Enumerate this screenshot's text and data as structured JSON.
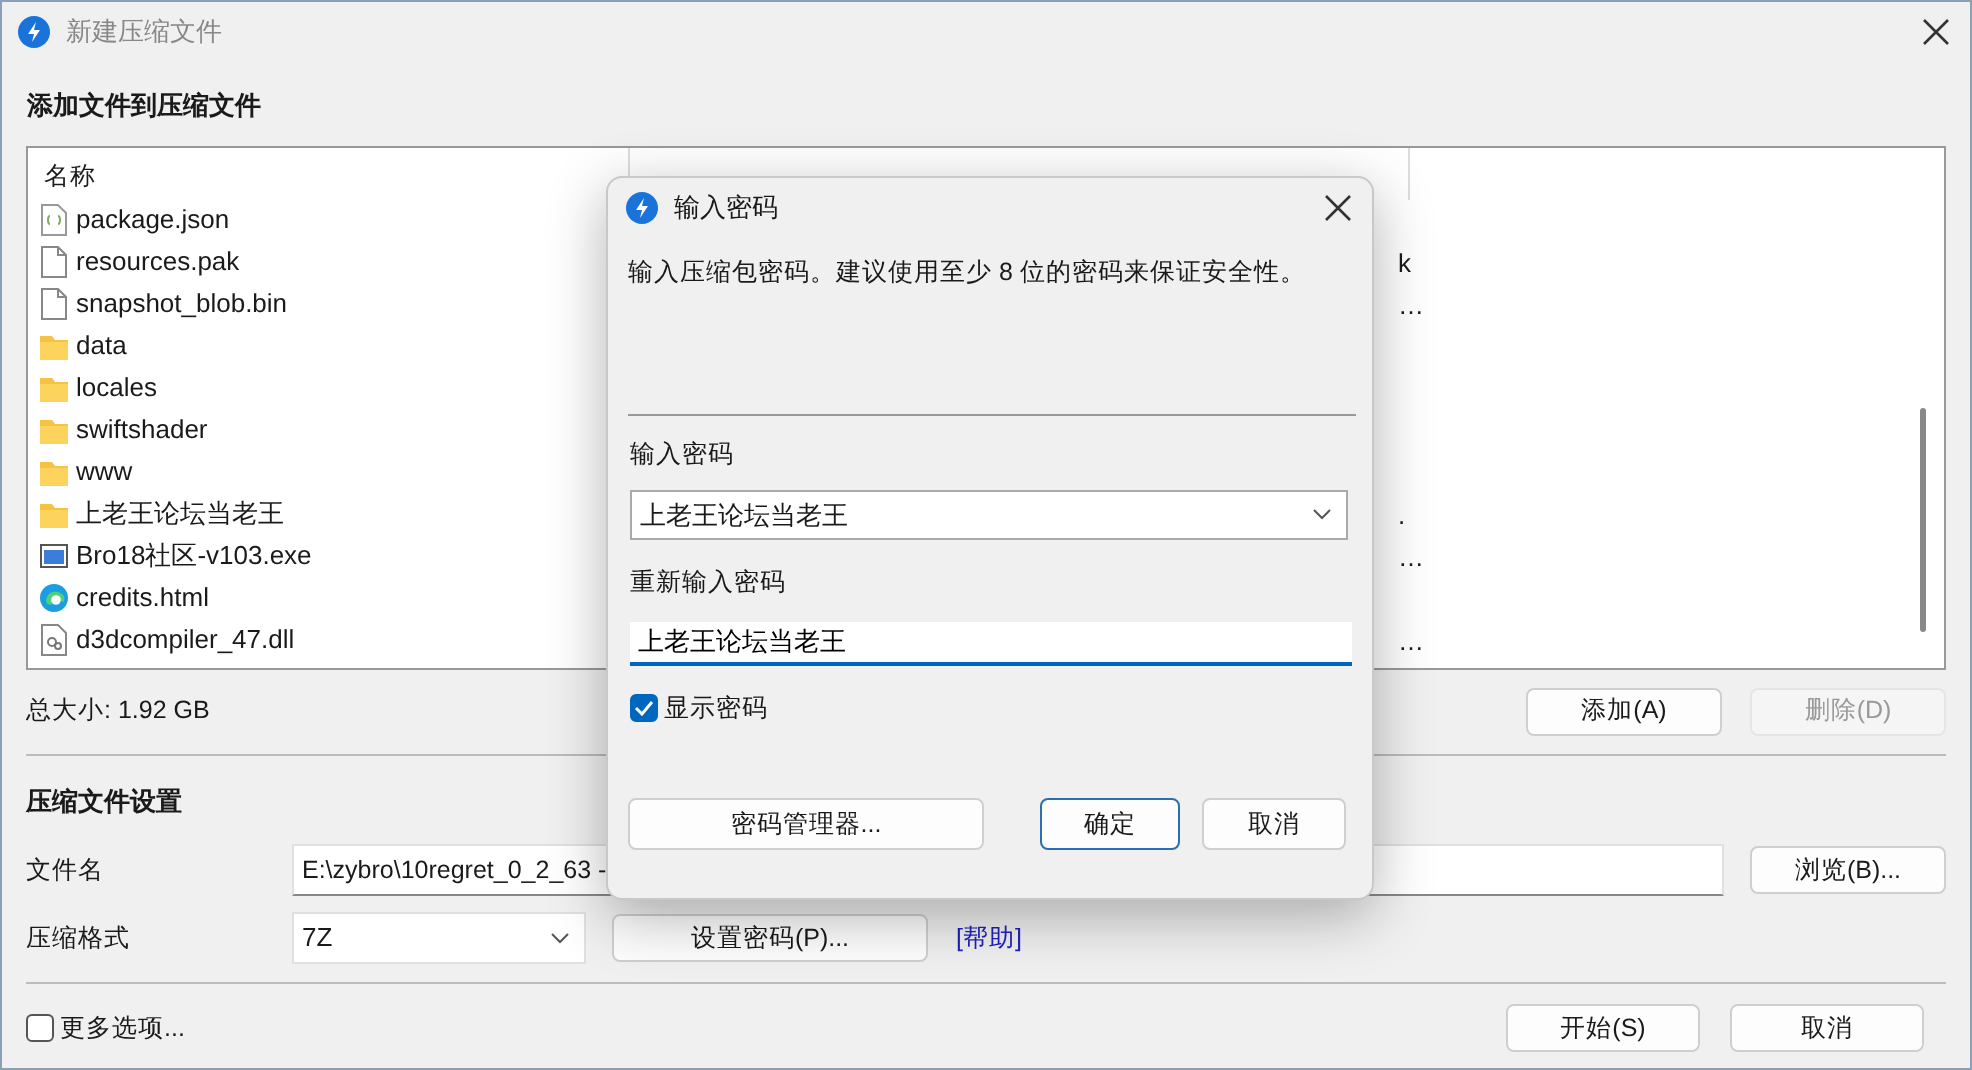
{
  "window": {
    "title": "新建压缩文件"
  },
  "add_section": {
    "heading": "添加文件到压缩文件"
  },
  "file_list": {
    "columns": [
      "名称"
    ],
    "rows": [
      {
        "kind": "json",
        "name": "package.json"
      },
      {
        "kind": "file",
        "name": "resources.pak",
        "path_tail": "k"
      },
      {
        "kind": "file",
        "name": "snapshot_blob.bin",
        "path_tail": "…"
      },
      {
        "kind": "folder",
        "name": "data"
      },
      {
        "kind": "folder",
        "name": "locales"
      },
      {
        "kind": "folder",
        "name": "swiftshader"
      },
      {
        "kind": "folder",
        "name": "www"
      },
      {
        "kind": "folder",
        "name": "上老王论坛当老王",
        "path_tail": "."
      },
      {
        "kind": "exe",
        "name": "Bro18社区-v103.exe",
        "path_tail": "…"
      },
      {
        "kind": "html",
        "name": "credits.html"
      },
      {
        "kind": "dll",
        "name": "d3dcompiler_47.dll",
        "path_tail": "…"
      }
    ]
  },
  "total_size": "总大小: 1.92 GB",
  "list_buttons": [
    {
      "label": "添加(A)",
      "disabled": false
    },
    {
      "label": "删除(D)",
      "disabled": true
    }
  ],
  "settings": {
    "heading": "压缩文件设置",
    "filename_label": "文件名",
    "filename_value": "E:\\zybro\\10regret_0_2_63 -",
    "browse_button": "浏览(B)...",
    "format_label": "压缩格式",
    "format_value": "7Z",
    "password_button": "设置密码(P)...",
    "help_link": "[帮助]"
  },
  "more_options": {
    "label": "更多选项...",
    "checked": false
  },
  "footer_buttons": [
    {
      "label": "开始(S)"
    },
    {
      "label": "取消"
    }
  ],
  "dialog": {
    "title": "输入密码",
    "message": "输入压缩包密码。建议使用至少 8 位的密码来保证安全性。",
    "password_label": "输入密码",
    "password_value": "上老王论坛当老王",
    "confirm_label": "重新输入密码",
    "confirm_value": "上老王论坛当老王",
    "show_password": {
      "label": "显示密码",
      "checked": true
    },
    "manager_button": "密码管理器...",
    "ok_button": "确定",
    "cancel_button": "取消"
  }
}
